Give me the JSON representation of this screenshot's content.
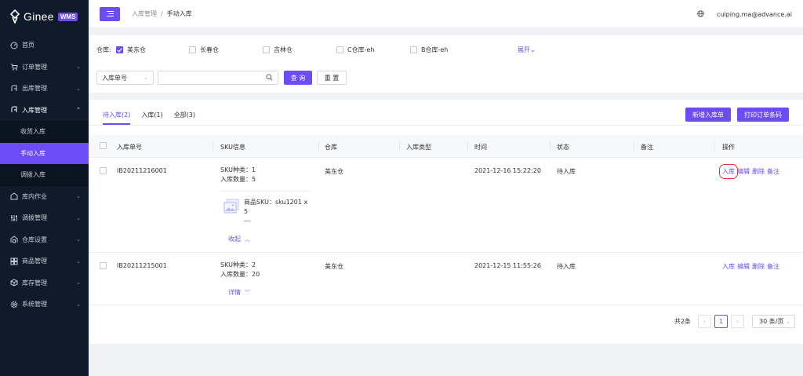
{
  "sidebar": {
    "logo_text": "Ginee",
    "badge": "WMS",
    "items": [
      {
        "label": "首页",
        "icon": "dashboard-icon"
      },
      {
        "label": "订单管理",
        "icon": "cart-icon"
      },
      {
        "label": "出库管理",
        "icon": "outbound-icon"
      },
      {
        "label": "入库管理",
        "icon": "inbound-icon"
      },
      {
        "label": "库内作业",
        "icon": "warehouse-ops-icon"
      },
      {
        "label": "调拨管理",
        "icon": "transfer-icon"
      },
      {
        "label": "仓库设置",
        "icon": "warehouse-settings-icon"
      },
      {
        "label": "商品管理",
        "icon": "product-icon"
      },
      {
        "label": "库存管理",
        "icon": "inventory-icon"
      },
      {
        "label": "系统管理",
        "icon": "system-icon"
      }
    ],
    "sub_items": [
      "收货入库",
      "手动入库",
      "调拨入库"
    ]
  },
  "header": {
    "breadcrumb_parent": "入库管理",
    "breadcrumb_sep": "/",
    "breadcrumb_current": "手动入库",
    "user_email": "cuiping.ma@advance.ai"
  },
  "filter": {
    "warehouse_label": "仓库:",
    "warehouses": [
      {
        "label": "美东仓",
        "checked": true
      },
      {
        "label": "长春仓",
        "checked": false
      },
      {
        "label": "吉林仓",
        "checked": false
      },
      {
        "label": "C仓库-eh",
        "checked": false
      },
      {
        "label": "B仓库-eh",
        "checked": false
      }
    ],
    "expand_label": "展开",
    "search_field": "入库单号",
    "search_placeholder": "",
    "query_button": "查 询",
    "reset_button": "重 置"
  },
  "tabs": [
    {
      "label": "待入库(2)",
      "active": true
    },
    {
      "label": "入库(1)",
      "active": false
    },
    {
      "label": "全部(3)",
      "active": false
    }
  ],
  "buttons": {
    "new_inbound": "新增入库单",
    "print_barcode": "打印订单条码"
  },
  "table": {
    "headers": [
      "入库单号",
      "SKU信息",
      "仓库",
      "入库类型",
      "时间",
      "状态",
      "备注",
      "操作"
    ],
    "rows": [
      {
        "order_no": "IB20211216001",
        "sku_types": "SKU种类：1",
        "inbound_qty": "入库数量：5",
        "product_line1": "商品SKU：sku1201 x 5",
        "product_line2": "---",
        "toggle": "收起",
        "warehouse": "美东仓",
        "time": "2021-12-16 15:22:20",
        "status": "待入库",
        "actions": [
          "入库",
          "编辑",
          "删除",
          "备注"
        ]
      },
      {
        "order_no": "IB20211215001",
        "sku_types": "SKU种类：2",
        "inbound_qty": "入库数量：20",
        "toggle": "详情",
        "warehouse": "美东仓",
        "time": "2021-12-15 11:55:26",
        "status": "待入库",
        "actions": [
          "入库",
          "编辑",
          "删除",
          "备注"
        ]
      }
    ]
  },
  "pagination": {
    "total": "共2条",
    "current_page": "1",
    "page_size": "30 条/页"
  },
  "colors": {
    "primary": "#6c4cf5",
    "sidebar_bg": "#0f1b2b",
    "highlight": "#e0382c"
  }
}
